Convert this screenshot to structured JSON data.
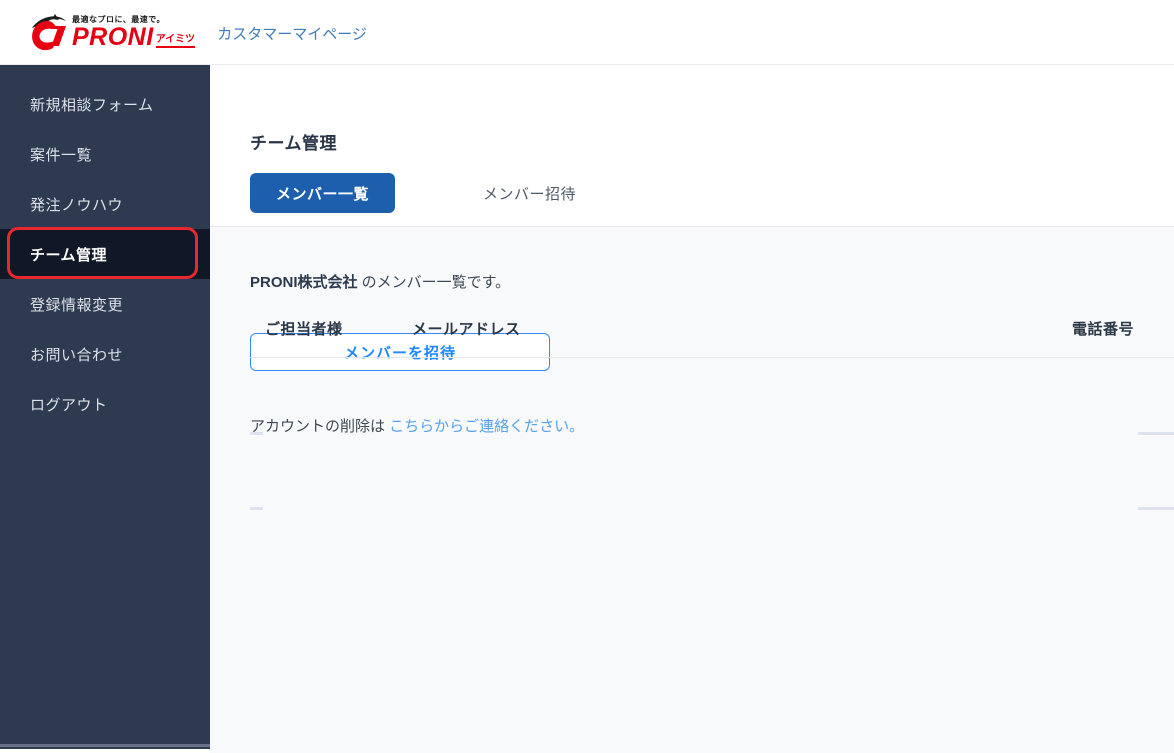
{
  "header": {
    "logo": {
      "tagline": "最適なプロに、最速で。",
      "brand": "PRONI",
      "brand_sub": "アイミツ"
    },
    "page_label": "カスタマーマイページ"
  },
  "sidebar": {
    "items": [
      {
        "label": "新規相談フォーム",
        "active": false
      },
      {
        "label": "案件一覧",
        "active": false
      },
      {
        "label": "発注ノウハウ",
        "active": false
      },
      {
        "label": "チーム管理",
        "active": true,
        "annotated": true
      },
      {
        "label": "登録情報変更",
        "active": false
      },
      {
        "label": "お問い合わせ",
        "active": false
      },
      {
        "label": "ログアウト",
        "active": false
      }
    ]
  },
  "main": {
    "title": "チーム管理",
    "tabs": [
      {
        "label": "メンバー一覧",
        "active": true
      },
      {
        "label": "メンバー招待",
        "active": false
      }
    ],
    "company_line": {
      "company_name": "PRONI株式会社",
      "suffix": " のメンバー一覧です。"
    },
    "invite_button_label": "メンバーを招待",
    "delete_line": {
      "prefix": "アカウントの削除は ",
      "link_text": "こちらからご連絡ください。"
    },
    "table": {
      "headers": [
        "ご担当者様",
        "メールアドレス",
        "電話番号"
      ],
      "rows": [
        {
          "name": "",
          "email": "",
          "phone": ""
        },
        {
          "name": "",
          "email": "",
          "phone": ""
        }
      ],
      "empty_placeholder": "skeleton-dash"
    }
  },
  "colors": {
    "brand_red": "#e60012",
    "annotation_red": "#e8282c",
    "sidebar_bg": "#2d3a50",
    "sidebar_active_bg": "#101828",
    "tab_active_blue": "#1d5fad",
    "invite_blue": "#1f87ff",
    "link_blue": "#57a0f0",
    "page_label_blue": "#3f7cba",
    "content_bg": "#f8f9fa",
    "text_dark": "#2a3648"
  }
}
